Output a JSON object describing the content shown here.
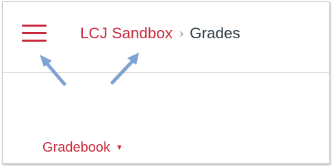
{
  "header": {
    "menu_icon": "hamburger-menu-icon",
    "breadcrumb": {
      "course": "LCJ Sandbox",
      "separator": "›",
      "current": "Grades"
    }
  },
  "annotations": {
    "arrow_icon": "arrow-icon",
    "arrow_color": "#7ea3d2"
  },
  "toolbar": {
    "gradebook_label": "Gradebook",
    "caret": "▼"
  },
  "colors": {
    "accent": "#c8283a",
    "text": "#2d3b45",
    "separator": "#8b8b8b"
  }
}
